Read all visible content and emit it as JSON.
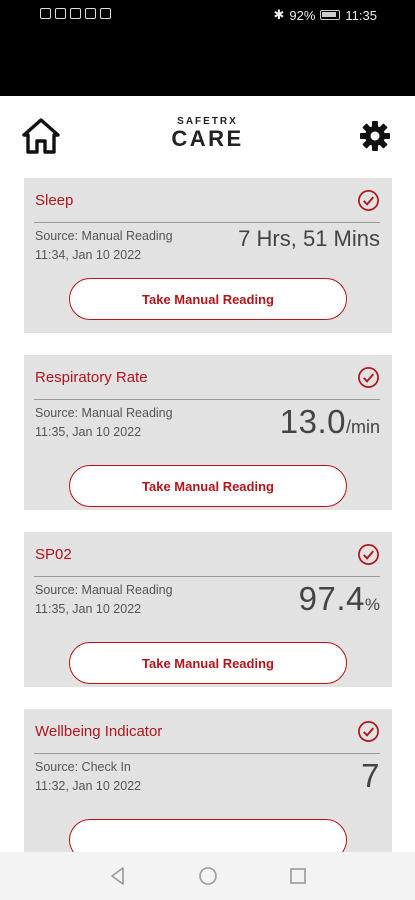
{
  "status_bar": {
    "battery": "92%",
    "time": "11:35"
  },
  "header": {
    "logo_small": "SAFETRX",
    "logo_big": "CARE",
    "icons": {
      "home": "home-icon",
      "settings": "gear-icon"
    }
  },
  "cards": [
    {
      "title": "Sleep",
      "source": "Source: Manual Reading",
      "timestamp": "11:34, Jan 10 2022",
      "value": "7 Hrs, 51 Mins",
      "unit": "",
      "button": "Take Manual Reading"
    },
    {
      "title": "Respiratory Rate",
      "source": "Source: Manual Reading",
      "timestamp": "11:35, Jan 10 2022",
      "value": "13.0",
      "unit": "/min",
      "button": "Take Manual Reading"
    },
    {
      "title": "SP02",
      "source": "Source: Manual Reading",
      "timestamp": "11:35, Jan 10 2022",
      "value": "97.4",
      "unit": "%",
      "button": "Take Manual Reading"
    },
    {
      "title": "Wellbeing Indicator",
      "source": "Source: Check In",
      "timestamp": "11:32, Jan 10 2022",
      "value": "7",
      "unit": "",
      "button": ""
    }
  ],
  "colors": {
    "accent": "#b0161b",
    "card_bg": "#e3e2e2",
    "status_bar": "#000000"
  },
  "nav": {
    "icons": [
      "back-icon",
      "home-circle-icon",
      "recents-icon"
    ]
  }
}
